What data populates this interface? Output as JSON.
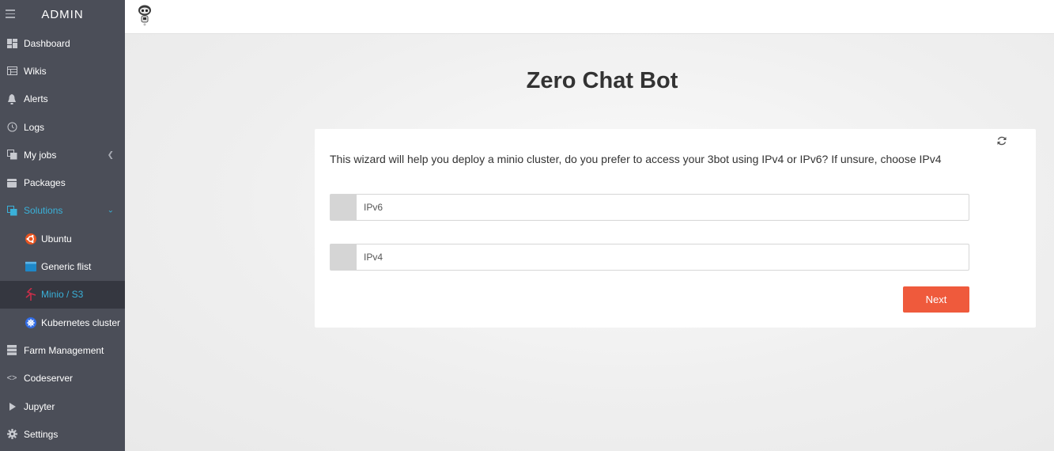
{
  "sidebar": {
    "title": "ADMIN",
    "items": [
      {
        "label": "Dashboard",
        "icon": "dashboard-icon"
      },
      {
        "label": "Wikis",
        "icon": "wiki-icon"
      },
      {
        "label": "Alerts",
        "icon": "bell-icon"
      },
      {
        "label": "Logs",
        "icon": "history-icon"
      },
      {
        "label": "My jobs",
        "icon": "jobs-icon"
      },
      {
        "label": "Packages",
        "icon": "package-icon"
      },
      {
        "label": "Solutions",
        "icon": "solutions-icon"
      },
      {
        "label": "Ubuntu",
        "icon": "ubuntu-icon"
      },
      {
        "label": "Generic flist",
        "icon": "flist-icon"
      },
      {
        "label": "Minio / S3",
        "icon": "minio-icon"
      },
      {
        "label": "Kubernetes cluster",
        "icon": "kubernetes-icon"
      },
      {
        "label": "Farm Management",
        "icon": "server-icon"
      },
      {
        "label": "Codeserver",
        "icon": "code-icon"
      },
      {
        "label": "Jupyter",
        "icon": "play-icon"
      },
      {
        "label": "Settings",
        "icon": "gear-icon"
      }
    ]
  },
  "page": {
    "title": "Zero Chat Bot"
  },
  "wizard": {
    "question": "This wizard will help you deploy a minio cluster, do you prefer to access your 3bot using IPv4 or IPv6? If unsure, choose IPv4",
    "options": [
      "IPv6",
      "IPv4"
    ],
    "next_label": "Next"
  },
  "colors": {
    "sidebar_bg": "#4b4e58",
    "sidebar_selected_bg": "#353740",
    "accent": "#3ab1d9",
    "next_button": "#ef5a3c"
  }
}
